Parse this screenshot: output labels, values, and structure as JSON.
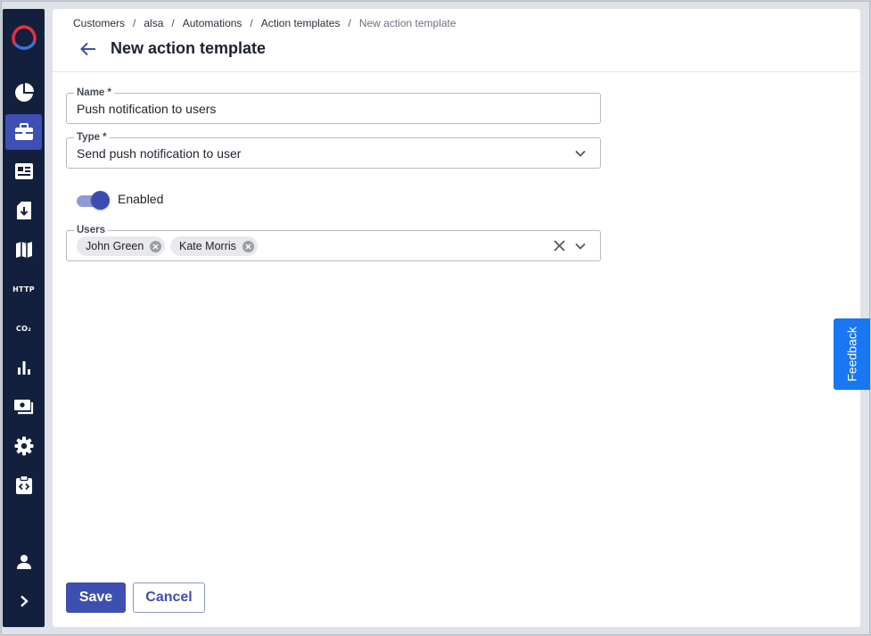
{
  "breadcrumb": {
    "items": [
      "Customers",
      "alsa",
      "Automations",
      "Action templates"
    ],
    "current": "New action template",
    "separator": "/"
  },
  "page": {
    "title": "New action template"
  },
  "form": {
    "name": {
      "label": "Name *",
      "value": "Push notification to users"
    },
    "type": {
      "label": "Type *",
      "value": "Send push notification to user"
    },
    "enabled": {
      "label": "Enabled",
      "checked": true
    },
    "users": {
      "label": "Users",
      "chips": [
        "John Green",
        "Kate Morris"
      ]
    }
  },
  "actions": {
    "save_label": "Save",
    "cancel_label": "Cancel"
  },
  "feedback": {
    "label": "Feedback"
  },
  "sidebar": {
    "items": [
      {
        "icon": "pie-chart-icon"
      },
      {
        "icon": "briefcase-icon",
        "active": true
      },
      {
        "icon": "newspaper-icon"
      },
      {
        "icon": "sim-card-download-icon"
      },
      {
        "icon": "map-icon"
      },
      {
        "icon": "http-icon",
        "text": "HTTP"
      },
      {
        "icon": "co2-icon",
        "text": "CO₂"
      },
      {
        "icon": "bar-chart-icon"
      },
      {
        "icon": "payments-icon"
      },
      {
        "icon": "gear-icon"
      },
      {
        "icon": "code-clipboard-icon"
      }
    ],
    "bottom": [
      {
        "icon": "user-icon"
      },
      {
        "icon": "chevron-right-icon"
      }
    ]
  },
  "colors": {
    "sidebar_bg": "#12203d",
    "accent": "#3e4fb2",
    "feedback_bg": "#1877f2",
    "logo_red": "#e5303d",
    "logo_blue": "#3e6fd8"
  }
}
